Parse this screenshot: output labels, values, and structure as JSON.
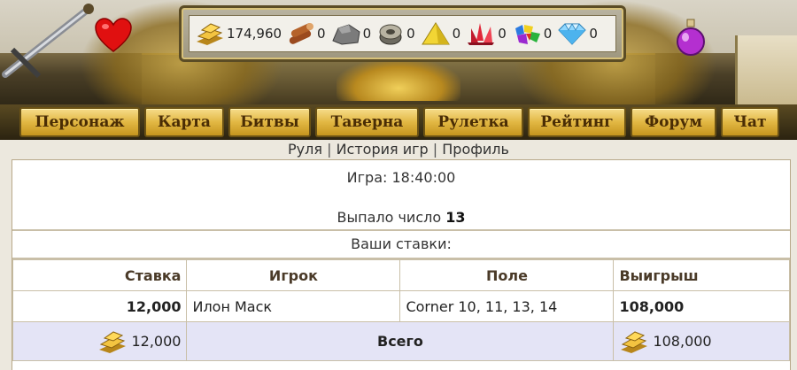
{
  "header": {
    "resources": [
      {
        "icon": "gold-bars-icon",
        "value": "174,960"
      },
      {
        "icon": "wood-logs-icon",
        "value": "0"
      },
      {
        "icon": "stone-icon",
        "value": "0"
      },
      {
        "icon": "iron-ore-icon",
        "value": "0"
      },
      {
        "icon": "sulfur-icon",
        "value": "0"
      },
      {
        "icon": "crystal-icon",
        "value": "0"
      },
      {
        "icon": "gems-icon",
        "value": "0"
      },
      {
        "icon": "diamond-icon",
        "value": "0"
      }
    ]
  },
  "nav": {
    "items": [
      {
        "label": "Персонаж"
      },
      {
        "label": "Карта"
      },
      {
        "label": "Битвы"
      },
      {
        "label": "Таверна"
      },
      {
        "label": "Рулетка"
      },
      {
        "label": "Рейтинг"
      },
      {
        "label": "Форум"
      },
      {
        "label": "Чат"
      }
    ]
  },
  "sublinks": {
    "roulette": "Руля",
    "history": "История игр",
    "profile": "Профиль",
    "separator": "|"
  },
  "game": {
    "time_label": "Игра: 18:40:00",
    "result_label": "Выпало число",
    "result_number": "13",
    "bets_title": "Ваши ставки:"
  },
  "bets_table": {
    "headers": {
      "stake": "Ставка",
      "player": "Игрок",
      "field": "Поле",
      "win": "Выигрыш"
    },
    "rows": [
      {
        "stake": "12,000",
        "player": "Илон Маск",
        "field": "Corner 10, 11, 13, 14",
        "win": "108,000"
      }
    ],
    "total": {
      "stake": "12,000",
      "label": "Всего",
      "win": "108,000"
    }
  },
  "colors": {
    "nav_button": "#e2b743",
    "total_row_bg": "#e4e4f6",
    "page_bg": "#ece8de"
  }
}
